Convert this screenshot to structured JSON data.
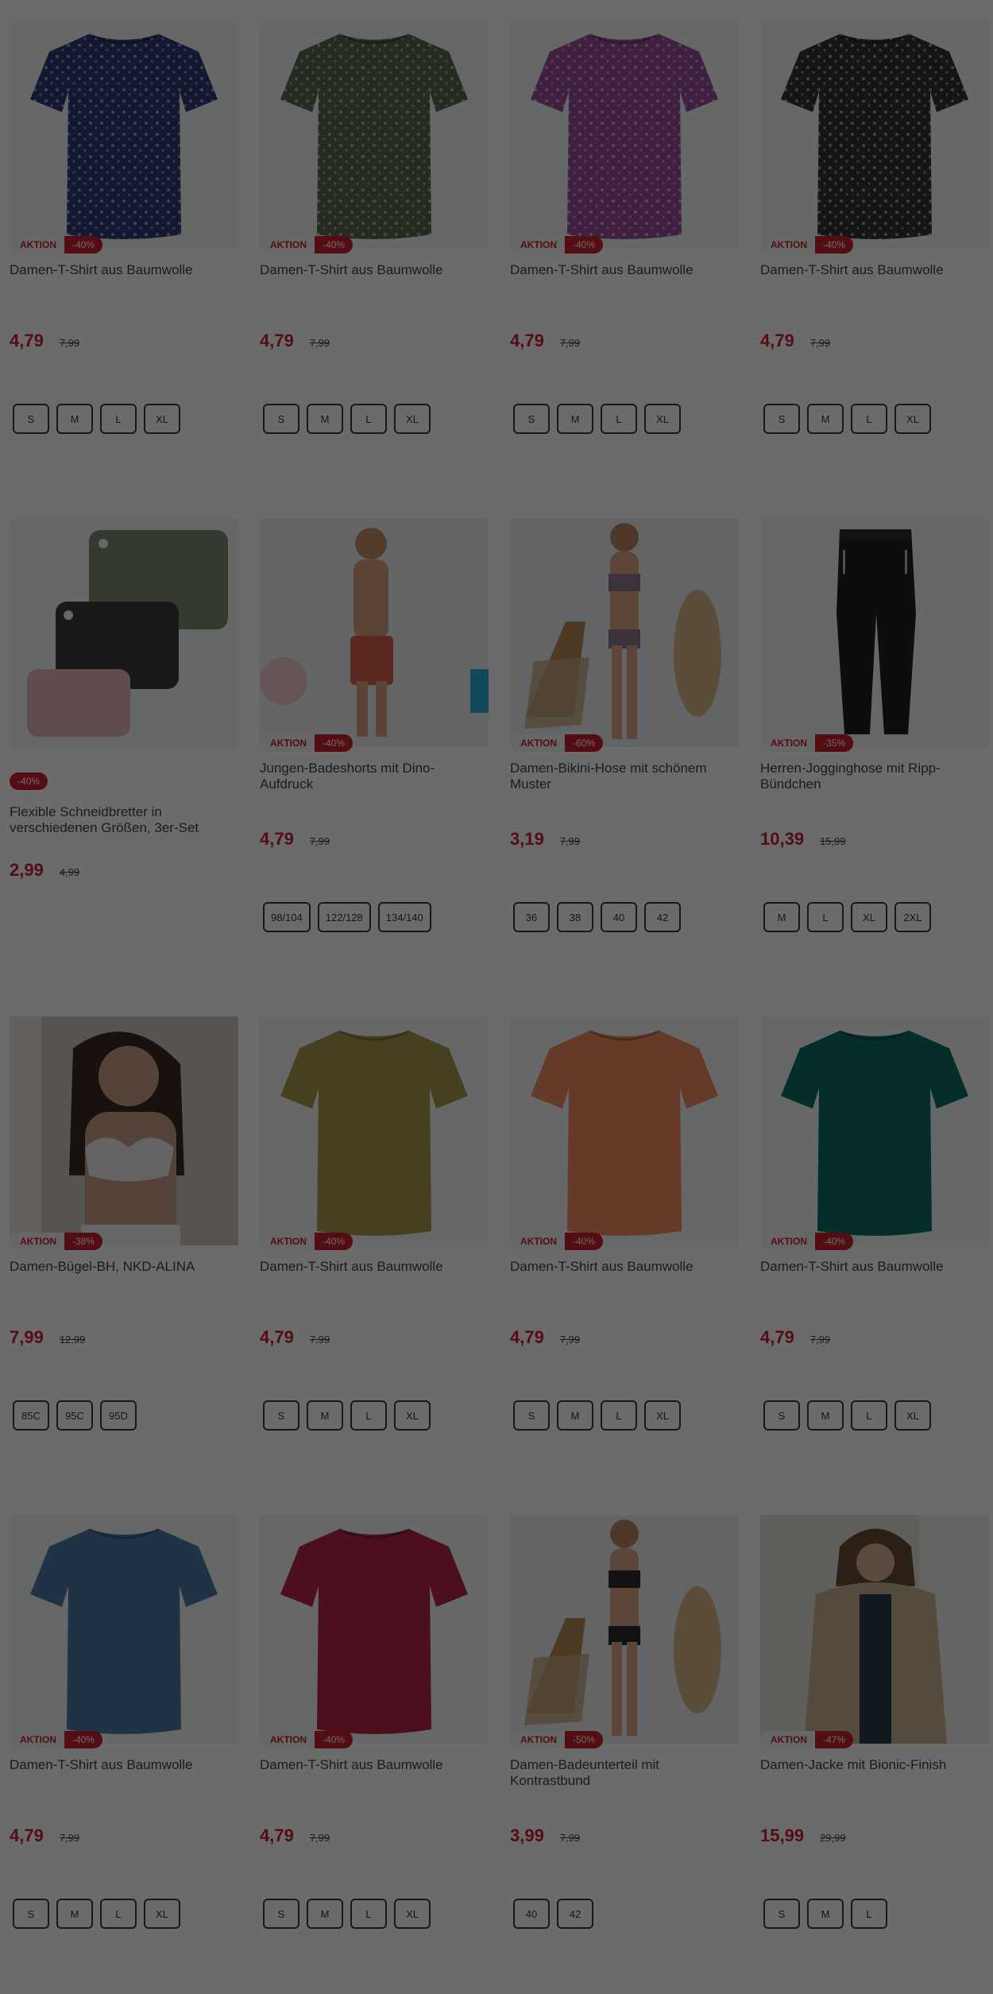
{
  "products": [
    {
      "title": "Damen-T-Shirt aus Baumwolle",
      "aktion": "AKTION",
      "discount": "-40%",
      "price": "4,79",
      "old_price": "7,99",
      "sizes": [
        "S",
        "M",
        "L",
        "XL"
      ],
      "image": "tshirt-floral",
      "color": "#2f3d78"
    },
    {
      "title": "Damen-T-Shirt aus Baumwolle",
      "aktion": "AKTION",
      "discount": "-40%",
      "price": "4,79",
      "old_price": "7,99",
      "sizes": [
        "S",
        "M",
        "L",
        "XL"
      ],
      "image": "tshirt-floral",
      "color": "#59664a"
    },
    {
      "title": "Damen-T-Shirt aus Baumwolle",
      "aktion": "AKTION",
      "discount": "-40%",
      "price": "4,79",
      "old_price": "7,99",
      "sizes": [
        "S",
        "M",
        "L",
        "XL"
      ],
      "image": "tshirt-floral",
      "color": "#9a4e9c"
    },
    {
      "title": "Damen-T-Shirt aus Baumwolle",
      "aktion": "AKTION",
      "discount": "-40%",
      "price": "4,79",
      "old_price": "7,99",
      "sizes": [
        "S",
        "M",
        "L",
        "XL"
      ],
      "image": "tshirt-floral",
      "color": "#333333"
    },
    {
      "title": "Flexible Schneidbretter in verschiedenen Größen, 3er-Set",
      "aktion": "",
      "discount": "-40%",
      "price": "2,99",
      "old_price": "4,99",
      "sizes": [],
      "image": "boards",
      "color": "#6e7864"
    },
    {
      "title": "Jungen-Badeshorts mit Dino-Aufdruck",
      "aktion": "AKTION",
      "discount": "-40%",
      "price": "4,79",
      "old_price": "7,99",
      "sizes": [
        "98/104",
        "122/128",
        "134/140"
      ],
      "image": "boy",
      "color": "#d9624b"
    },
    {
      "title": "Damen-Bikini-Hose mit schönem Muster",
      "aktion": "AKTION",
      "discount": "-60%",
      "price": "3,19",
      "old_price": "7,99",
      "sizes": [
        "36",
        "38",
        "40",
        "42"
      ],
      "image": "bikini",
      "color": "#8a7a8e"
    },
    {
      "title": "Herren-Jogginghose mit Ripp-Bündchen",
      "aktion": "AKTION",
      "discount": "-35%",
      "price": "10,39",
      "old_price": "15,99",
      "sizes": [
        "M",
        "L",
        "XL",
        "2XL"
      ],
      "image": "pants",
      "color": "#1f1f1f"
    },
    {
      "title": "Damen-Bügel-BH, NKD-ALINA",
      "aktion": "AKTION",
      "discount": "-38%",
      "price": "7,99",
      "old_price": "12,99",
      "sizes": [
        "85C",
        "95C",
        "95D"
      ],
      "image": "bra",
      "color": "#eeeeee"
    },
    {
      "title": "Damen-T-Shirt aus Baumwolle",
      "aktion": "AKTION",
      "discount": "-40%",
      "price": "4,79",
      "old_price": "7,99",
      "sizes": [
        "S",
        "M",
        "L",
        "XL"
      ],
      "image": "tshirt-plain",
      "color": "#a8994f"
    },
    {
      "title": "Damen-T-Shirt aus Baumwolle",
      "aktion": "AKTION",
      "discount": "-40%",
      "price": "4,79",
      "old_price": "7,99",
      "sizes": [
        "S",
        "M",
        "L",
        "XL"
      ],
      "image": "tshirt-plain",
      "color": "#f08a5f"
    },
    {
      "title": "Damen-T-Shirt aus Baumwolle",
      "aktion": "AKTION",
      "discount": "-40%",
      "price": "4,79",
      "old_price": "7,99",
      "sizes": [
        "S",
        "M",
        "L",
        "XL"
      ],
      "image": "tshirt-plain",
      "color": "#0d6e68"
    },
    {
      "title": "Damen-T-Shirt aus Baumwolle",
      "aktion": "AKTION",
      "discount": "-40%",
      "price": "4,79",
      "old_price": "7,99",
      "sizes": [
        "S",
        "M",
        "L",
        "XL"
      ],
      "image": "tshirt-plain",
      "color": "#4c7aa6"
    },
    {
      "title": "Damen-T-Shirt aus Baumwolle",
      "aktion": "AKTION",
      "discount": "-40%",
      "price": "4,79",
      "old_price": "7,99",
      "sizes": [
        "S",
        "M",
        "L",
        "XL"
      ],
      "image": "tshirt-plain",
      "color": "#b42447"
    },
    {
      "title": "Damen-Badeunterteil mit Kontrastbund",
      "aktion": "AKTION",
      "discount": "-50%",
      "price": "3,99",
      "old_price": "7,99",
      "sizes": [
        "40",
        "42"
      ],
      "image": "bikini",
      "color": "#2b2b2b"
    },
    {
      "title": "Damen-Jacke mit Bionic-Finish",
      "aktion": "AKTION",
      "discount": "-47%",
      "price": "15,99",
      "old_price": "29,99",
      "sizes": [
        "S",
        "M",
        "L"
      ],
      "image": "jacket",
      "color": "#c9b38f"
    }
  ]
}
